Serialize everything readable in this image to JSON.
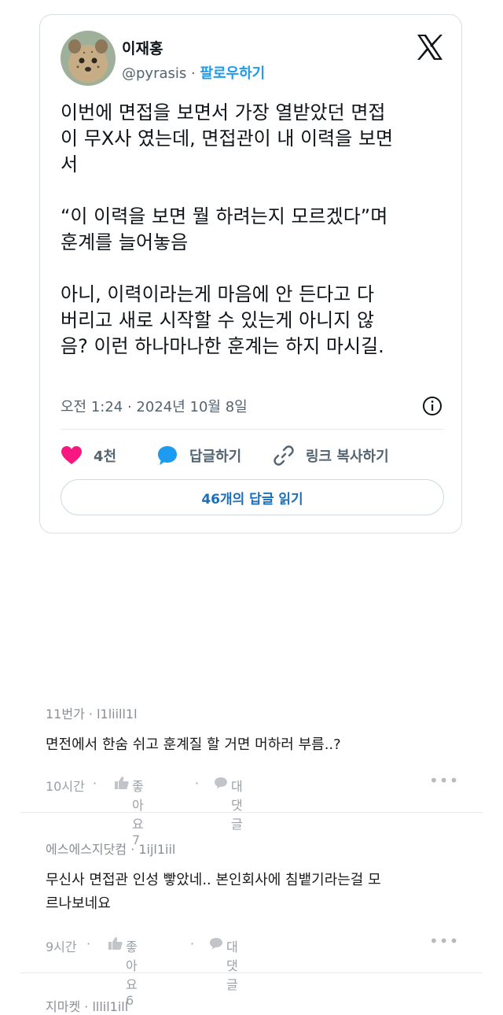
{
  "tweet": {
    "author_name": "이재홍",
    "author_handle": "@pyrasis",
    "dot": " · ",
    "follow_label": "팔로우하기",
    "text": "이번에 면접을 보면서 가장 열받았던 면접\n이 무X사 였는데, 면접관이 내 이력을 보면\n서\n\n“이 이력을 보면 뭘 하려는지 모르겠다”며\n훈계를 늘어놓음\n\n아니, 이력이라는게 마음에 안 든다고 다\n버리고 새로 시작할 수 있는게 아니지 않\n음? 이런 하나마나한 훈계는 하지 마시길.",
    "timestamp": "오전 1:24 · 2024년 10월 8일",
    "likes": "4천",
    "reply_label": "답글하기",
    "copy_link_label": "링크 복사하기",
    "read_replies_label": "46개의 답글 읽기"
  },
  "comments": [
    {
      "author": "11번가",
      "id": "l1liill1l",
      "text": "면전에서 한숨 쉬고 훈계질 할 거면 머하러 부름..?",
      "time": "10시간",
      "like_label": "좋아요 7",
      "reply_label": "대댓글"
    },
    {
      "author": "에스에스지닷컴",
      "id": "1ijl1iil",
      "text": "무신사 면접관 인성 빻았네.. 본인회사에 침뱉기라는걸 모\n르나보네요",
      "time": "9시간",
      "like_label": "좋아요 6",
      "reply_label": "대댓글"
    },
    {
      "author": "지마켓",
      "id": "lllil1ill"
    }
  ],
  "colors": {
    "accent": "#1d9bf0",
    "heart": "#f91880",
    "muted": "#536471"
  }
}
